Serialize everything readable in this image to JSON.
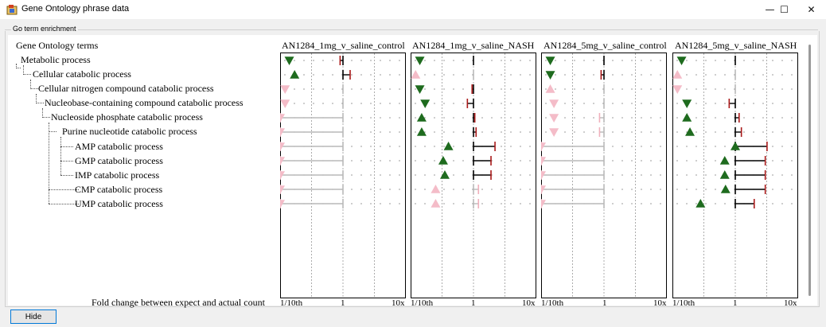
{
  "window": {
    "title": "Gene Ontology phrase data",
    "minimize_glyph": "—",
    "maximize_glyph": "☐",
    "close_glyph": "✕"
  },
  "group": {
    "label": "Go term enrichment"
  },
  "tree": {
    "header": "Gene Ontology terms",
    "items": [
      {
        "label": "Metabolic process",
        "level": 0
      },
      {
        "label": "Cellular catabolic process",
        "level": 1
      },
      {
        "label": "Cellular nitrogen compound catabolic process",
        "level": 2
      },
      {
        "label": "Nucleobase-containing compound catabolic process",
        "level": 3
      },
      {
        "label": "Nucleoside phosphate catabolic process",
        "level": 4
      },
      {
        "label": "Purine nucleotide catabolic process",
        "level": 5
      },
      {
        "label": "AMP catabolic process",
        "level": 6
      },
      {
        "label": "GMP catabolic process",
        "level": 6
      },
      {
        "label": "IMP catabolic process",
        "level": 6
      },
      {
        "label": "CMP catabolic process",
        "level": 5
      },
      {
        "label": "UMP catabolic process",
        "level": 5
      }
    ]
  },
  "footer": {
    "axis_label": "Fold change between expect and actual count",
    "ticks": [
      "1/10th",
      "1",
      "10x"
    ]
  },
  "hide_button": "Hide",
  "chart_data": {
    "type": "scatter",
    "x_scale": "log",
    "xlim": [
      0.1,
      10
    ],
    "colors": {
      "up": "#1e6b1e",
      "down": "#1e6b1e",
      "faint": "#f4bcc8",
      "bar": "#000000",
      "bar_faint": "#b9b9b9",
      "marker": "#aa1a1a",
      "marker_faint": "#f0b0bc"
    },
    "panels": [
      {
        "title": "AN1284_1mg_v_saline_control",
        "rows": [
          {
            "dir": "down",
            "sig": true,
            "fc": 0.9,
            "pos": 0.14
          },
          {
            "dir": "up",
            "sig": true,
            "fc": 1.3,
            "pos": 0.17
          },
          {
            "dir": "down",
            "sig": false,
            "fc": 1.0,
            "pos": 0.12
          },
          {
            "dir": "down",
            "sig": false,
            "fc": 1.0,
            "pos": 0.12
          },
          {
            "dir": "down",
            "sig": false,
            "fc": 0.1,
            "pos": 0.1
          },
          {
            "dir": "down",
            "sig": false,
            "fc": 0.1,
            "pos": 0.1
          },
          {
            "dir": "down",
            "sig": false,
            "fc": 0.1,
            "pos": 0.1
          },
          {
            "dir": "down",
            "sig": false,
            "fc": 0.1,
            "pos": 0.1
          },
          {
            "dir": "down",
            "sig": false,
            "fc": 0.1,
            "pos": 0.1
          },
          {
            "dir": "down",
            "sig": false,
            "fc": 0.1,
            "pos": 0.1
          },
          {
            "dir": "down",
            "sig": false,
            "fc": 0.1,
            "pos": 0.1
          }
        ]
      },
      {
        "title": "AN1284_1mg_v_saline_NASH",
        "rows": [
          {
            "dir": "down",
            "sig": true,
            "fc": 1.0,
            "pos": 0.14
          },
          {
            "dir": "up",
            "sig": false,
            "fc": 1.0,
            "pos": 0.12
          },
          {
            "dir": "down",
            "sig": true,
            "fc": 0.95,
            "pos": 0.14
          },
          {
            "dir": "down",
            "sig": true,
            "fc": 0.8,
            "pos": 0.17
          },
          {
            "dir": "up",
            "sig": true,
            "fc": 1.05,
            "pos": 0.15
          },
          {
            "dir": "up",
            "sig": true,
            "fc": 1.1,
            "pos": 0.15
          },
          {
            "dir": "up",
            "sig": true,
            "fc": 2.2,
            "pos": 0.4
          },
          {
            "dir": "up",
            "sig": true,
            "fc": 1.9,
            "pos": 0.33
          },
          {
            "dir": "up",
            "sig": true,
            "fc": 1.9,
            "pos": 0.35
          },
          {
            "dir": "up",
            "sig": false,
            "fc": 1.2,
            "pos": 0.25
          },
          {
            "dir": "up",
            "sig": false,
            "fc": 1.2,
            "pos": 0.25
          }
        ]
      },
      {
        "title": "AN1284_5mg_v_saline_control",
        "rows": [
          {
            "dir": "down",
            "sig": true,
            "fc": 1.0,
            "pos": 0.14
          },
          {
            "dir": "down",
            "sig": true,
            "fc": 0.9,
            "pos": 0.14
          },
          {
            "dir": "up",
            "sig": false,
            "fc": 1.0,
            "pos": 0.14
          },
          {
            "dir": "down",
            "sig": false,
            "fc": 1.0,
            "pos": 0.16
          },
          {
            "dir": "down",
            "sig": false,
            "fc": 0.85,
            "pos": 0.16
          },
          {
            "dir": "down",
            "sig": false,
            "fc": 0.85,
            "pos": 0.16
          },
          {
            "dir": "down",
            "sig": false,
            "fc": 0.1,
            "pos": 0.1
          },
          {
            "dir": "down",
            "sig": false,
            "fc": 0.1,
            "pos": 0.1
          },
          {
            "dir": "down",
            "sig": false,
            "fc": 0.1,
            "pos": 0.1
          },
          {
            "dir": "down",
            "sig": false,
            "fc": 0.1,
            "pos": 0.1
          },
          {
            "dir": "down",
            "sig": false,
            "fc": 0.1,
            "pos": 0.1
          }
        ]
      },
      {
        "title": "AN1284_5mg_v_saline_NASH",
        "rows": [
          {
            "dir": "down",
            "sig": true,
            "fc": 1.0,
            "pos": 0.14
          },
          {
            "dir": "up",
            "sig": false,
            "fc": 1.0,
            "pos": 0.12
          },
          {
            "dir": "down",
            "sig": false,
            "fc": 1.0,
            "pos": 0.12
          },
          {
            "dir": "down",
            "sig": true,
            "fc": 0.8,
            "pos": 0.17
          },
          {
            "dir": "up",
            "sig": true,
            "fc": 1.15,
            "pos": 0.17
          },
          {
            "dir": "up",
            "sig": true,
            "fc": 1.25,
            "pos": 0.19
          },
          {
            "dir": "up",
            "sig": true,
            "fc": 3.2,
            "pos": 1.0
          },
          {
            "dir": "up",
            "sig": true,
            "fc": 3.0,
            "pos": 0.68
          },
          {
            "dir": "up",
            "sig": true,
            "fc": 3.0,
            "pos": 0.68
          },
          {
            "dir": "up",
            "sig": true,
            "fc": 3.0,
            "pos": 0.7
          },
          {
            "dir": "up",
            "sig": true,
            "fc": 2.0,
            "pos": 0.28
          }
        ]
      }
    ]
  }
}
